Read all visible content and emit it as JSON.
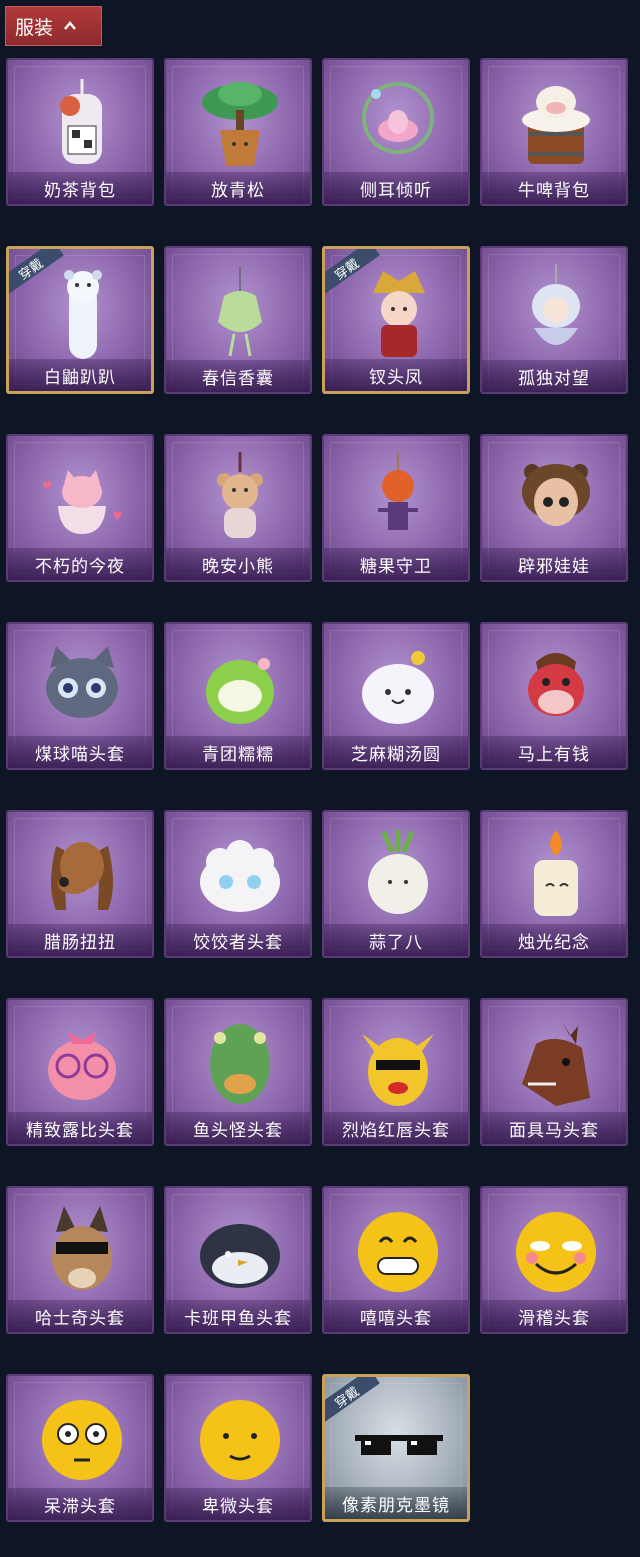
{
  "header": {
    "tab_label": "服装"
  },
  "badge_text": "穿戴",
  "items": [
    {
      "name": "奶茶背包"
    },
    {
      "name": "放青松"
    },
    {
      "name": "侧耳倾听"
    },
    {
      "name": "牛啤背包"
    },
    {
      "name": "白鼬趴趴"
    },
    {
      "name": "春信香囊"
    },
    {
      "name": "钗头凤"
    },
    {
      "name": "孤独对望"
    },
    {
      "name": "不朽的今夜"
    },
    {
      "name": "晚安小熊"
    },
    {
      "name": "糖果守卫"
    },
    {
      "name": "辟邪娃娃"
    },
    {
      "name": "煤球喵头套"
    },
    {
      "name": "青团糯糯"
    },
    {
      "name": "芝麻糊汤圆"
    },
    {
      "name": "马上有钱"
    },
    {
      "name": "腊肠扭扭"
    },
    {
      "name": "饺饺者头套"
    },
    {
      "name": "蒜了八"
    },
    {
      "name": "烛光纪念"
    },
    {
      "name": "精致露比头套"
    },
    {
      "name": "鱼头怪头套"
    },
    {
      "name": "烈焰红唇头套"
    },
    {
      "name": "面具马头套"
    },
    {
      "name": "哈士奇头套"
    },
    {
      "name": "卡班甲鱼头套"
    },
    {
      "name": "嘻嘻头套"
    },
    {
      "name": "滑稽头套"
    },
    {
      "name": "呆滞头套"
    },
    {
      "name": "卑微头套"
    },
    {
      "name": "像素朋克墨镜"
    }
  ],
  "colors": {
    "card_purple": "#8d66ad",
    "equipped_border": "#c9a15b",
    "header_red": "#a13334"
  }
}
